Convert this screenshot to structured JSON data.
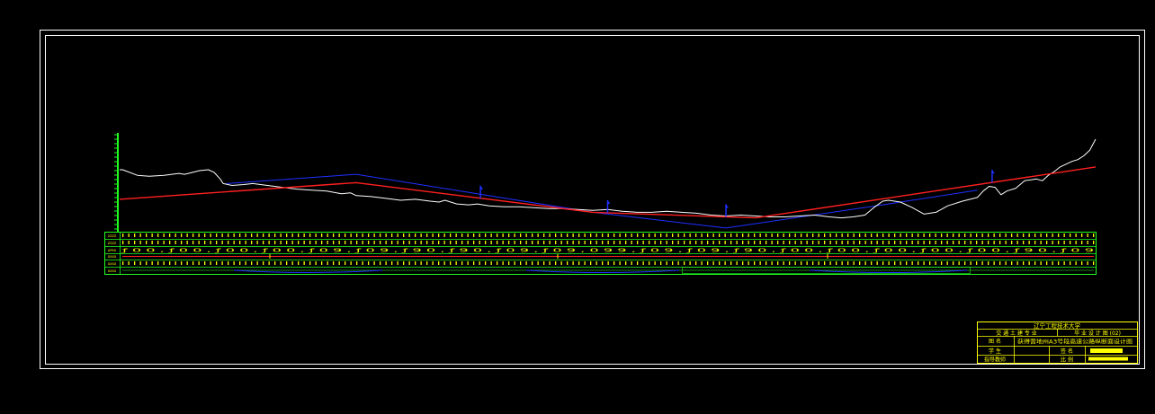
{
  "drawing": {
    "background": "#000000",
    "colors": {
      "frame": "#ffffff",
      "ground_line": "#ffffff",
      "design_grade": "#ff2020",
      "tangent_line": "#2030ff",
      "elevation_axis": "#20ff20",
      "data_band_border": "#20ff20",
      "data_band_text": "#ffff00",
      "title_block": "#ffff00"
    }
  },
  "profile_chart": {
    "type": "line",
    "title": "",
    "series": [
      {
        "key": "ground",
        "values": [
          [
            0,
            67
          ],
          [
            1,
            67
          ],
          [
            6,
            61
          ],
          [
            10,
            60
          ],
          [
            15,
            61
          ],
          [
            20,
            63
          ],
          [
            22,
            62
          ],
          [
            27,
            66
          ],
          [
            30,
            67
          ],
          [
            32,
            64
          ],
          [
            34,
            57
          ],
          [
            35,
            52
          ],
          [
            38,
            50
          ],
          [
            42,
            51
          ],
          [
            45,
            52
          ],
          [
            50,
            50
          ],
          [
            55,
            48
          ],
          [
            60,
            46
          ],
          [
            65,
            45
          ],
          [
            70,
            44
          ],
          [
            75,
            41
          ],
          [
            78,
            42
          ],
          [
            80,
            39
          ],
          [
            85,
            38
          ],
          [
            90,
            36
          ],
          [
            95,
            34
          ],
          [
            100,
            35
          ],
          [
            105,
            33
          ],
          [
            108,
            32
          ],
          [
            110,
            34
          ],
          [
            114,
            30
          ],
          [
            118,
            29
          ],
          [
            121,
            30
          ],
          [
            125,
            28
          ],
          [
            130,
            27
          ],
          [
            135,
            27
          ],
          [
            140,
            26
          ],
          [
            145,
            25
          ],
          [
            150,
            25
          ],
          [
            155,
            24
          ],
          [
            160,
            23
          ],
          [
            165,
            24
          ],
          [
            170,
            22
          ],
          [
            175,
            21
          ],
          [
            180,
            21
          ],
          [
            185,
            22
          ],
          [
            190,
            21
          ],
          [
            195,
            20
          ],
          [
            200,
            18
          ],
          [
            205,
            17
          ],
          [
            210,
            18
          ],
          [
            215,
            17
          ],
          [
            220,
            16
          ],
          [
            225,
            16
          ],
          [
            230,
            17
          ],
          [
            235,
            18
          ],
          [
            240,
            16
          ],
          [
            244,
            15
          ],
          [
            248,
            16
          ],
          [
            252,
            18
          ],
          [
            255,
            26
          ],
          [
            258,
            33
          ],
          [
            260,
            34
          ],
          [
            264,
            32
          ],
          [
            268,
            26
          ],
          [
            272,
            19
          ],
          [
            276,
            21
          ],
          [
            280,
            28
          ],
          [
            285,
            33
          ],
          [
            290,
            37
          ],
          [
            292,
            44
          ],
          [
            294,
            49
          ],
          [
            296,
            48
          ],
          [
            298,
            40
          ],
          [
            300,
            44
          ],
          [
            303,
            47
          ],
          [
            306,
            55
          ],
          [
            310,
            57
          ],
          [
            312,
            55
          ],
          [
            314,
            61
          ],
          [
            316,
            65
          ],
          [
            318,
            70
          ],
          [
            320,
            73
          ],
          [
            322,
            76
          ],
          [
            324,
            78
          ],
          [
            326,
            82
          ],
          [
            328,
            88
          ],
          [
            330,
            100
          ]
        ]
      },
      {
        "key": "design_grade",
        "values": [
          [
            0,
            35
          ],
          [
            80,
            53
          ],
          [
            160,
            21
          ],
          [
            215,
            15
          ],
          [
            330,
            70
          ]
        ]
      },
      {
        "key": "tangent_line",
        "values": [
          [
            36,
            52
          ],
          [
            80,
            62
          ],
          [
            160,
            21
          ],
          [
            205,
            4
          ],
          [
            260,
            30
          ],
          [
            290,
            45
          ]
        ]
      }
    ],
    "markers": [
      {
        "x": 122,
        "label": ""
      },
      {
        "x": 165,
        "label": ""
      },
      {
        "x": 205,
        "label": ""
      },
      {
        "x": 295,
        "label": ""
      }
    ]
  },
  "data_band": {
    "row_labels": [
      "ZZZZ",
      "ZZZZ",
      "AP9X",
      "XXXX",
      "XXXX",
      "XXXX"
    ],
    "row_styles": [
      "ticks",
      "ticks",
      "numbers",
      "grade",
      "ticks",
      "curve"
    ],
    "numbers_text": "ƒ 0 0 , ƒ 0 0 , ƒ 0 0 , ƒ 0 0 , ƒ 0 9 , ƒ 0 9 , ƒ 9 0 , ƒ 9 0 , ƒ 0 9 , ƒ 0 9 , 0 9 9 , ƒ 0 9 , ƒ 0 9 , ƒ 9 0 , ƒ 0 0 , ƒ 0 0 , ƒ 0 0 , ƒ 0 0 , ƒ 0 0 , ƒ 9 0 , ƒ 0 9"
  },
  "title_block": {
    "university": "辽宁工程技术大学",
    "department": "交 通 土 建 专 业",
    "drawing_type": "毕 业 设 计 图 (02)",
    "name_label": "图    名",
    "drawing_name": "获得营地州A3号段高速公路纵断面设计图",
    "student_label": "学    生",
    "student_value": "",
    "date_label": "签    名",
    "supervisor_label": "指导教师",
    "supervisor_value": "",
    "scale_label": "比    例"
  }
}
